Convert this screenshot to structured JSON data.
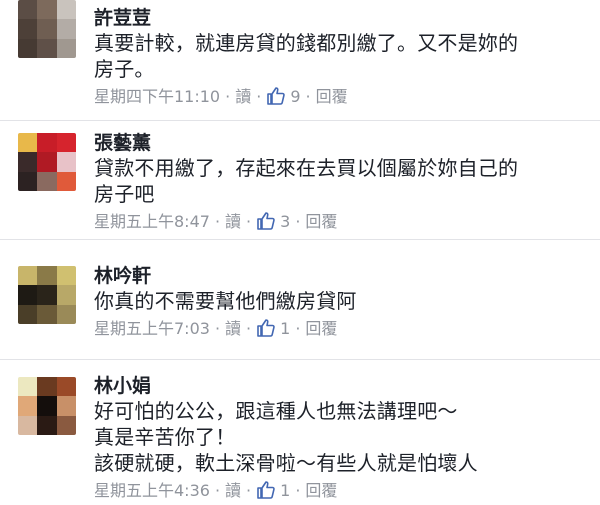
{
  "meta_labels": {
    "read": "讀",
    "reply": "回覆",
    "dot": "·"
  },
  "colors": {
    "author": "#1d2129",
    "meta": "#90949c",
    "like_icon": "#4267b2",
    "separator": "#e2e3e7"
  },
  "comments": [
    {
      "author": "許荳荳",
      "lines": [
        "真要計較，就連房貸的錢都別繳了。又不是妳的",
        "房子。"
      ],
      "timestamp": "星期四下午11:10",
      "likes": "9",
      "avatar_pixels": [
        "#5b4d45",
        "#7d6a5c",
        "#c9c3bd",
        "#4d4038",
        "#6f5e52",
        "#b3aca6",
        "#463a33",
        "#5f5048",
        "#a09890"
      ]
    },
    {
      "author": "張藝薰",
      "lines": [
        "貸款不用繳了，存起來在去買以個屬於妳自己的",
        "房子吧"
      ],
      "timestamp": "星期五上午8:47",
      "likes": "3",
      "avatar_pixels": [
        "#e8b84a",
        "#c81d28",
        "#d6242d",
        "#3a2a2a",
        "#b01a24",
        "#e8c2c8",
        "#2c2222",
        "#8a6a60",
        "#e05a3a"
      ]
    },
    {
      "author": "林吟軒",
      "lines": [
        "你真的不需要幫他們繳房貸阿"
      ],
      "timestamp": "星期五上午7:03",
      "likes": "1",
      "avatar_pixels": [
        "#c8b56a",
        "#8a7a48",
        "#d0c070",
        "#1e1a14",
        "#2a241a",
        "#b8a868",
        "#4a3e28",
        "#6a5a38",
        "#9a8a58"
      ]
    },
    {
      "author": "林小娟",
      "lines": [
        "好可怕的公公，跟這種人也無法講理吧～",
        "真是辛苦你了！",
        "該硬就硬，軟土深骨啦～有些人就是怕壞人"
      ],
      "timestamp": "星期五上午4:36",
      "likes": "1",
      "avatar_pixels": [
        "#ece8c0",
        "#6a3a20",
        "#9a4a28",
        "#e0a878",
        "#140e0c",
        "#c89068",
        "#d8b8a0",
        "#2a1a14",
        "#8a5a40"
      ]
    }
  ]
}
